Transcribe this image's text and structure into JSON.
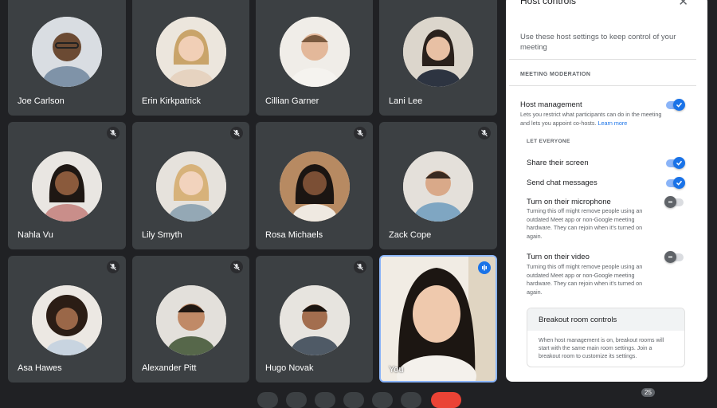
{
  "participants": [
    {
      "name": "Joe Carlson",
      "muted": false
    },
    {
      "name": "Erin Kirkpatrick",
      "muted": false
    },
    {
      "name": "Cillian Garner",
      "muted": false
    },
    {
      "name": "Lani Lee",
      "muted": false
    },
    {
      "name": "Nahla Vu",
      "muted": true
    },
    {
      "name": "Lily Smyth",
      "muted": true
    },
    {
      "name": "Rosa Michaels",
      "muted": true
    },
    {
      "name": "Zack Cope",
      "muted": true
    },
    {
      "name": "Asa Hawes",
      "muted": true
    },
    {
      "name": "Alexander Pitt",
      "muted": true
    },
    {
      "name": "Hugo Novak",
      "muted": true
    },
    {
      "name": "You",
      "muted": false,
      "speaking": true
    }
  ],
  "panel": {
    "title": "Host controls",
    "close_icon": "close-icon",
    "intro": "Use these host settings to keep control of your meeting",
    "section": "MEETING MODERATION",
    "host_management": {
      "label": "Host management",
      "desc": "Lets you restrict what participants can do in the meeting and lets you appoint co-hosts.",
      "link": "Learn more",
      "on": true
    },
    "let_everyone": "LET EVERYONE",
    "share_screen": {
      "label": "Share their screen",
      "on": true
    },
    "chat": {
      "label": "Send chat messages",
      "on": true
    },
    "microphone": {
      "label": "Turn on their microphone",
      "desc": "Turning this off might remove people using an outdated Meet app or non-Google meeting hardware. They can rejoin when it's turned on again.",
      "on": false
    },
    "video": {
      "label": "Turn on their video",
      "desc": "Turning this off might remove people using an outdated Meet app or non-Google meeting hardware. They can rejoin when it's turned on again.",
      "on": false
    },
    "breakout": {
      "title": "Breakout room controls",
      "desc": "When host management is on, breakout rooms will start with the same main room settings. Join a breakout room to customize its settings."
    }
  },
  "people_count": "25",
  "colors": {
    "accent": "#1a73e8",
    "tile": "#3c4043",
    "background": "#202124",
    "end_call": "#ea4335"
  }
}
